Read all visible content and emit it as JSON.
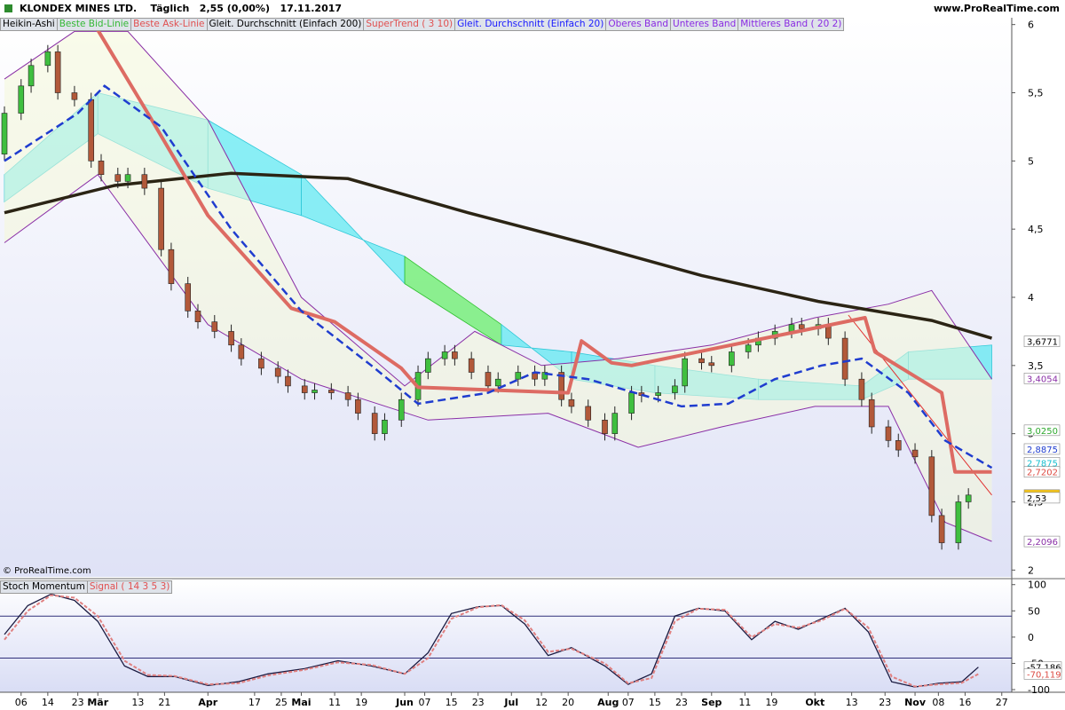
{
  "header": {
    "title": "KLONDEX MINES LTD.    Täglich   2,55 (0,00%)   17.11.2017",
    "url": "www.ProRealTime.com"
  },
  "legend_main": [
    {
      "label": "Heikin-Ashi",
      "color": "#000000"
    },
    {
      "label": "Beste Bid-Linie",
      "color": "#34b834"
    },
    {
      "label": "Beste Ask-Linie",
      "color": "#e05050"
    },
    {
      "label": "Gleit. Durchschnitt (Einfach 200)",
      "color": "#000000"
    },
    {
      "label": "SuperTrend ( 3 10)",
      "color": "#e05050"
    },
    {
      "label": "Gleit. Durchschnitt (Einfach 20)",
      "color": "#1a1aff"
    },
    {
      "label": "Oberes Band",
      "color": "#8a2be2"
    },
    {
      "label": "Unteres Band",
      "color": "#8a2be2"
    },
    {
      "label": "Mittleres Band ( 20 2)",
      "color": "#8a2be2"
    }
  ],
  "legend_sub": [
    {
      "label": "Stoch Momentum",
      "color": "#000000"
    },
    {
      "label": "Signal ( 14 3 5 3)",
      "color": "#e05050"
    }
  ],
  "copyright": "© ProRealTime.com",
  "colors": {
    "up": "#3fbf3f",
    "down": "#b2593a",
    "ma200": "#2b2414",
    "ma20": "#1f3ccf",
    "supertrend": "#dd6b63",
    "bollinger": "#8a2fa6",
    "cloud_green": "#48ef48",
    "cloud_cyan": "#40e8f0",
    "stoch": "#1a1a40",
    "signal": "#e08080"
  },
  "chart_data": [
    {
      "type": "candlestick",
      "title": "KLONDEX MINES LTD.",
      "y_ticks": [
        "6",
        "5,5",
        "5",
        "4,5",
        "4",
        "3,5",
        "3",
        "2,5",
        "2"
      ],
      "y_tick_values": [
        6,
        5.5,
        5,
        4.5,
        4,
        3.5,
        3,
        2.5,
        2
      ],
      "ylim": [
        1.95,
        6.05
      ],
      "x_ticks": [
        "06",
        "14",
        "23",
        "Mär",
        "13",
        "21",
        "Apr",
        "17",
        "25",
        "Mai",
        "11",
        "19",
        "Jun",
        "07",
        "15",
        "23",
        "Jul",
        "12",
        "20",
        "Aug",
        "07",
        "15",
        "23",
        "Sep",
        "11",
        "19",
        "Okt",
        "13",
        "23",
        "Nov",
        "08",
        "16",
        "27"
      ],
      "x_tick_dates": [
        "2017-02-06",
        "2017-02-14",
        "2017-02-23",
        "2017-03-01",
        "2017-03-13",
        "2017-03-21",
        "2017-04-03",
        "2017-04-17",
        "2017-04-25",
        "2017-05-01",
        "2017-05-11",
        "2017-05-19",
        "2017-06-01",
        "2017-06-07",
        "2017-06-15",
        "2017-06-23",
        "2017-07-03",
        "2017-07-12",
        "2017-07-20",
        "2017-08-01",
        "2017-08-07",
        "2017-08-15",
        "2017-08-23",
        "2017-09-01",
        "2017-09-11",
        "2017-09-19",
        "2017-10-02",
        "2017-10-13",
        "2017-10-23",
        "2017-11-01",
        "2017-11-08",
        "2017-11-16",
        "2017-11-27"
      ],
      "price_labels": [
        {
          "text": "3,6771",
          "value": 3.6771,
          "color": "#000000",
          "bg": "#ffffff"
        },
        {
          "text": "3,4054",
          "value": 3.4054,
          "color": "#8a2fa6",
          "bg": "#ffffff"
        },
        {
          "text": "3,0250",
          "value": 3.025,
          "color": "#2ea82e",
          "bg": "#ffffff"
        },
        {
          "text": "2,8875",
          "value": 2.8875,
          "color": "#1f3ccf",
          "bg": "#ffffff"
        },
        {
          "text": "2,7875",
          "value": 2.7875,
          "color": "#19c0d0",
          "bg": "#ffffff"
        },
        {
          "text": "2,7202",
          "value": 2.7202,
          "color": "#dd4b43",
          "bg": "#ffffff"
        },
        {
          "text": "2,55",
          "value": 2.55,
          "color": "#000000",
          "bg": "#f5c518"
        },
        {
          "text": "2,53",
          "value": 2.53,
          "color": "#000000",
          "bg": "#ffffff"
        },
        {
          "text": "2,2096",
          "value": 2.2096,
          "color": "#8a2fa6",
          "bg": "#ffffff"
        }
      ],
      "ma200": {
        "x": [
          "2017-02-01",
          "2017-03-06",
          "2017-04-10",
          "2017-05-15",
          "2017-06-20",
          "2017-07-26",
          "2017-08-29",
          "2017-10-03",
          "2017-11-06",
          "2017-11-24"
        ],
        "y": [
          4.62,
          4.82,
          4.91,
          4.87,
          4.62,
          4.39,
          4.16,
          3.97,
          3.83,
          3.7
        ]
      },
      "ma20": {
        "x": [
          "2017-02-01",
          "2017-02-23",
          "2017-03-03",
          "2017-03-20",
          "2017-04-10",
          "2017-05-01",
          "2017-05-22",
          "2017-06-05",
          "2017-06-26",
          "2017-07-10",
          "2017-07-26",
          "2017-08-09",
          "2017-08-23",
          "2017-09-06",
          "2017-09-20",
          "2017-10-04",
          "2017-10-16",
          "2017-10-30",
          "2017-11-10",
          "2017-11-24"
        ],
        "y": [
          5.0,
          5.35,
          5.55,
          5.25,
          4.5,
          3.9,
          3.5,
          3.22,
          3.3,
          3.45,
          3.4,
          3.3,
          3.2,
          3.22,
          3.4,
          3.5,
          3.55,
          3.3,
          2.95,
          2.75
        ]
      },
      "supertrend": {
        "x": [
          "2017-02-22",
          "2017-02-28",
          "2017-03-16",
          "2017-04-03",
          "2017-04-28",
          "2017-05-11",
          "2017-05-31",
          "2017-06-05",
          "2017-07-20",
          "2017-07-24",
          "2017-08-02",
          "2017-08-08",
          "2017-10-17",
          "2017-10-20",
          "2017-11-09",
          "2017-11-13",
          "2017-11-24"
        ],
        "y": [
          6.0,
          6.0,
          5.35,
          4.6,
          3.92,
          3.82,
          3.48,
          3.34,
          3.3,
          3.68,
          3.52,
          3.5,
          3.85,
          3.6,
          3.3,
          2.72,
          2.72
        ]
      },
      "bollinger_upper": {
        "x": [
          "2017-02-01",
          "2017-02-22",
          "2017-03-10",
          "2017-04-03",
          "2017-05-01",
          "2017-06-01",
          "2017-06-22",
          "2017-07-12",
          "2017-08-04",
          "2017-09-01",
          "2017-10-02",
          "2017-10-24",
          "2017-11-06",
          "2017-11-24"
        ],
        "y": [
          5.6,
          5.95,
          5.95,
          5.3,
          4.0,
          3.35,
          3.75,
          3.5,
          3.55,
          3.65,
          3.85,
          3.95,
          4.05,
          3.4
        ]
      },
      "bollinger_lower": {
        "x": [
          "2017-02-01",
          "2017-03-01",
          "2017-04-03",
          "2017-05-01",
          "2017-06-08",
          "2017-07-14",
          "2017-08-10",
          "2017-09-04",
          "2017-10-02",
          "2017-10-24",
          "2017-11-10",
          "2017-11-24"
        ],
        "y": [
          4.4,
          4.9,
          3.8,
          3.4,
          3.1,
          3.15,
          2.9,
          3.05,
          3.2,
          3.2,
          2.35,
          2.21
        ]
      },
      "cloud": {
        "x": [
          "2017-02-01",
          "2017-03-01",
          "2017-04-03",
          "2017-05-01",
          "2017-06-01",
          "2017-06-30",
          "2017-07-21",
          "2017-08-15",
          "2017-09-15",
          "2017-10-16",
          "2017-10-30",
          "2017-11-24"
        ],
        "span_a": [
          4.7,
          5.2,
          4.8,
          4.6,
          4.3,
          3.8,
          3.4,
          3.3,
          3.25,
          3.25,
          3.4,
          3.4
        ],
        "span_b": [
          4.9,
          5.5,
          5.3,
          4.9,
          4.1,
          3.65,
          3.6,
          3.5,
          3.4,
          3.35,
          3.6,
          3.65
        ]
      },
      "trend_line": {
        "x": [
          "2017-10-12",
          "2017-11-24"
        ],
        "y": [
          3.87,
          2.55
        ]
      },
      "candles": {
        "dates": [
          "2017-02-01",
          "2017-02-06",
          "2017-02-09",
          "2017-02-14",
          "2017-02-17",
          "2017-02-22",
          "2017-02-27",
          "2017-03-02",
          "2017-03-07",
          "2017-03-10",
          "2017-03-15",
          "2017-03-20",
          "2017-03-23",
          "2017-03-28",
          "2017-03-31",
          "2017-04-05",
          "2017-04-10",
          "2017-04-13",
          "2017-04-19",
          "2017-04-24",
          "2017-04-27",
          "2017-05-02",
          "2017-05-05",
          "2017-05-10",
          "2017-05-15",
          "2017-05-18",
          "2017-05-23",
          "2017-05-26",
          "2017-05-31",
          "2017-06-05",
          "2017-06-08",
          "2017-06-13",
          "2017-06-16",
          "2017-06-21",
          "2017-06-26",
          "2017-06-29",
          "2017-07-05",
          "2017-07-10",
          "2017-07-13",
          "2017-07-18",
          "2017-07-21",
          "2017-07-26",
          "2017-07-31",
          "2017-08-03",
          "2017-08-08",
          "2017-08-11",
          "2017-08-16",
          "2017-08-21",
          "2017-08-24",
          "2017-08-29",
          "2017-09-01",
          "2017-09-07",
          "2017-09-12",
          "2017-09-15",
          "2017-09-20",
          "2017-09-25",
          "2017-09-28",
          "2017-10-03",
          "2017-10-06",
          "2017-10-11",
          "2017-10-16",
          "2017-10-19",
          "2017-10-24",
          "2017-10-27",
          "2017-11-01",
          "2017-11-06",
          "2017-11-09",
          "2017-11-14",
          "2017-11-17"
        ],
        "open": [
          5.05,
          5.35,
          5.55,
          5.7,
          5.8,
          5.5,
          5.45,
          5.0,
          4.9,
          4.85,
          4.9,
          4.8,
          4.35,
          4.1,
          3.9,
          3.82,
          3.75,
          3.65,
          3.55,
          3.48,
          3.42,
          3.35,
          3.3,
          3.32,
          3.3,
          3.25,
          3.15,
          3.0,
          3.1,
          3.25,
          3.45,
          3.55,
          3.6,
          3.55,
          3.45,
          3.35,
          3.4,
          3.45,
          3.4,
          3.45,
          3.25,
          3.2,
          3.1,
          3.0,
          3.15,
          3.3,
          3.28,
          3.3,
          3.35,
          3.55,
          3.52,
          3.5,
          3.6,
          3.65,
          3.7,
          3.75,
          3.8,
          3.77,
          3.8,
          3.7,
          3.4,
          3.25,
          3.05,
          2.95,
          2.88,
          2.83,
          2.4,
          2.2,
          2.5
        ],
        "close": [
          5.35,
          5.55,
          5.7,
          5.8,
          5.5,
          5.45,
          5.0,
          4.9,
          4.85,
          4.9,
          4.8,
          4.35,
          4.1,
          3.9,
          3.82,
          3.75,
          3.65,
          3.55,
          3.48,
          3.42,
          3.35,
          3.3,
          3.32,
          3.3,
          3.25,
          3.15,
          3.0,
          3.1,
          3.25,
          3.45,
          3.55,
          3.6,
          3.55,
          3.45,
          3.35,
          3.4,
          3.45,
          3.4,
          3.45,
          3.25,
          3.2,
          3.1,
          3.0,
          3.15,
          3.3,
          3.28,
          3.3,
          3.35,
          3.55,
          3.52,
          3.5,
          3.6,
          3.65,
          3.7,
          3.75,
          3.8,
          3.77,
          3.8,
          3.7,
          3.4,
          3.25,
          3.05,
          2.95,
          2.88,
          2.83,
          2.4,
          2.2,
          2.5,
          2.55
        ]
      }
    },
    {
      "type": "line",
      "title": "Stoch Momentum",
      "y_ticks": [
        "100",
        "50",
        "0",
        "-50",
        "-100"
      ],
      "y_tick_values": [
        100,
        50,
        0,
        -50,
        -100
      ],
      "ylim": [
        -105,
        108
      ],
      "levels": [
        40,
        -40
      ],
      "value_labels": [
        {
          "text": "-57,186",
          "value": -57.186,
          "color": "#000000"
        },
        {
          "text": "-70,119",
          "value": -70.119,
          "color": "#dd4b43"
        }
      ],
      "series": [
        {
          "name": "Stoch Momentum",
          "x": [
            "2017-02-01",
            "2017-02-08",
            "2017-02-15",
            "2017-02-22",
            "2017-03-01",
            "2017-03-09",
            "2017-03-16",
            "2017-03-24",
            "2017-04-03",
            "2017-04-12",
            "2017-04-21",
            "2017-05-02",
            "2017-05-12",
            "2017-05-22",
            "2017-06-01",
            "2017-06-08",
            "2017-06-15",
            "2017-06-23",
            "2017-06-30",
            "2017-07-07",
            "2017-07-14",
            "2017-07-21",
            "2017-07-31",
            "2017-08-07",
            "2017-08-14",
            "2017-08-21",
            "2017-08-28",
            "2017-09-05",
            "2017-09-13",
            "2017-09-20",
            "2017-09-27",
            "2017-10-04",
            "2017-10-11",
            "2017-10-18",
            "2017-10-25",
            "2017-11-01",
            "2017-11-08",
            "2017-11-15",
            "2017-11-20"
          ],
          "values": [
            5,
            60,
            82,
            70,
            30,
            -55,
            -75,
            -75,
            -92,
            -85,
            -70,
            -60,
            -45,
            -55,
            -70,
            -30,
            45,
            58,
            60,
            25,
            -35,
            -20,
            -55,
            -90,
            -70,
            40,
            55,
            50,
            -5,
            30,
            15,
            35,
            55,
            10,
            -85,
            -95,
            -88,
            -85,
            -57.2
          ]
        },
        {
          "name": "Signal ( 14 3 5 3)",
          "x": [
            "2017-02-01",
            "2017-02-08",
            "2017-02-15",
            "2017-02-22",
            "2017-03-01",
            "2017-03-09",
            "2017-03-16",
            "2017-03-24",
            "2017-04-03",
            "2017-04-12",
            "2017-04-21",
            "2017-05-02",
            "2017-05-12",
            "2017-05-22",
            "2017-06-01",
            "2017-06-08",
            "2017-06-15",
            "2017-06-23",
            "2017-06-30",
            "2017-07-07",
            "2017-07-14",
            "2017-07-21",
            "2017-07-31",
            "2017-08-07",
            "2017-08-14",
            "2017-08-21",
            "2017-08-28",
            "2017-09-05",
            "2017-09-13",
            "2017-09-20",
            "2017-09-27",
            "2017-10-04",
            "2017-10-11",
            "2017-10-18",
            "2017-10-25",
            "2017-11-01",
            "2017-11-08",
            "2017-11-15",
            "2017-11-20"
          ],
          "values": [
            -5,
            50,
            80,
            75,
            40,
            -45,
            -72,
            -74,
            -90,
            -88,
            -73,
            -62,
            -48,
            -53,
            -70,
            -40,
            35,
            57,
            61,
            32,
            -28,
            -22,
            -50,
            -88,
            -78,
            30,
            54,
            52,
            0,
            25,
            18,
            32,
            54,
            18,
            -75,
            -94,
            -90,
            -87,
            -70.1
          ]
        }
      ],
      "x_tick_dates": [
        "2017-02-06",
        "2017-02-14",
        "2017-02-23",
        "2017-03-01",
        "2017-03-13",
        "2017-03-21",
        "2017-04-03",
        "2017-04-17",
        "2017-04-25",
        "2017-05-01",
        "2017-05-11",
        "2017-05-19",
        "2017-06-01",
        "2017-06-07",
        "2017-06-15",
        "2017-06-23",
        "2017-07-03",
        "2017-07-12",
        "2017-07-20",
        "2017-08-01",
        "2017-08-07",
        "2017-08-15",
        "2017-08-23",
        "2017-09-01",
        "2017-09-11",
        "2017-09-19",
        "2017-10-02",
        "2017-10-13",
        "2017-10-23",
        "2017-11-01",
        "2017-11-08",
        "2017-11-16",
        "2017-11-27"
      ]
    }
  ]
}
